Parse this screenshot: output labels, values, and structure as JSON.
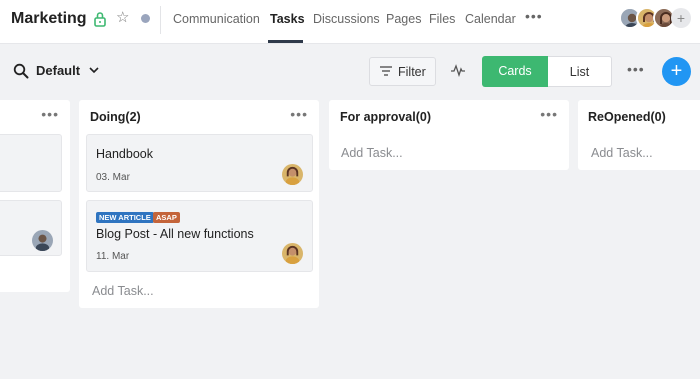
{
  "header": {
    "title": "Marketing",
    "tabs": [
      {
        "label": "Communication"
      },
      {
        "label": "Tasks"
      },
      {
        "label": "Discussions"
      },
      {
        "label": "Pages"
      },
      {
        "label": "Files"
      },
      {
        "label": "Calendar"
      }
    ],
    "more": "•••",
    "add_member": "+"
  },
  "toolbar": {
    "view_name": "Default",
    "filter_label": "Filter",
    "cards_label": "Cards",
    "list_label": "List",
    "more": "•••",
    "add": "+"
  },
  "board": {
    "columns": [
      {
        "title": "",
        "more": "•••",
        "add_task": ""
      },
      {
        "title": "Doing(2)",
        "more": "•••",
        "add_task": "Add Task...",
        "cards": [
          {
            "title": "Handbook",
            "date": "03. Mar"
          },
          {
            "title": "Blog Post - All new functions",
            "date": "11. Mar",
            "tags": [
              "NEW ARTICLE",
              "ASAP"
            ]
          }
        ]
      },
      {
        "title": "For approval(0)",
        "more": "•••",
        "add_task": "Add Task..."
      },
      {
        "title": "ReOpened(0)",
        "add_task": "Add Task..."
      }
    ]
  },
  "colors": {
    "accent_green": "#3db871",
    "accent_blue": "#2196f3",
    "tag_new_article": "#2f74c0",
    "tag_asap": "#c4643a"
  }
}
